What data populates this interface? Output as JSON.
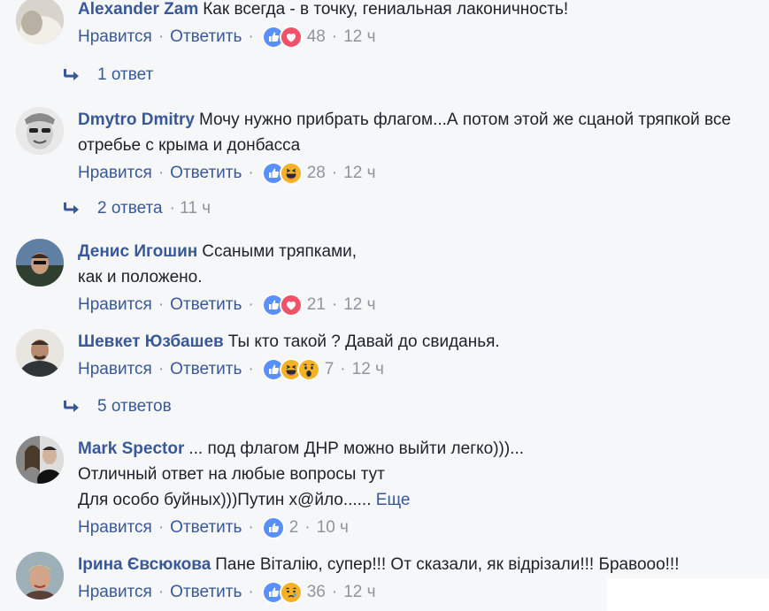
{
  "colors": {
    "link": "#385898",
    "meta": "#90949c",
    "like": "#5890ff",
    "love": "#f25268",
    "haha": "#f7b125"
  },
  "labels": {
    "like": "Нравится",
    "reply": "Ответить",
    "dot": "·",
    "more": "Еще"
  },
  "comments": [
    {
      "author": "Alexander Zam",
      "text": "Как всегда - в точку, гениальная лаконичность!",
      "reactions": [
        "like-reaction-icon",
        "love-reaction-icon"
      ],
      "count": "48",
      "time": "12 ч"
    },
    {
      "author": "Dmytro Dmitry",
      "text": "Мочу нужно прибрать флагом...А потом этой же сцаной тряпкой все отребье с крыма и донбасса",
      "reactions": [
        "like-reaction-icon",
        "haha-reaction-icon"
      ],
      "count": "28",
      "time": "12 ч"
    },
    {
      "author": "Денис Игошин",
      "text": "Ссаными тряпками,",
      "text2": "как и положено.",
      "reactions": [
        "like-reaction-icon",
        "love-reaction-icon"
      ],
      "count": "21",
      "time": "12 ч"
    },
    {
      "author": "Шевкет Юзбашев",
      "text": "Ты кто такой ? Давай до свиданья.",
      "reactions": [
        "like-reaction-icon",
        "haha-reaction-icon",
        "wow-reaction-icon"
      ],
      "count": "7",
      "time": "12 ч"
    },
    {
      "author": "Mark Spector",
      "text": "... под флагом ДНР можно выйти легко)))...",
      "text2": "Отличный ответ на любые вопросы тут",
      "text3": "Для особо буйных)))Путин х@йло......",
      "reactions": [
        "like-reaction-icon"
      ],
      "count": "2",
      "time": "10 ч"
    },
    {
      "author": "Ірина Євсюкова",
      "text": "Пане Віталію, супер!!! От сказали, як відрізали!!! Бравооо!!!",
      "reactions": [
        "like-reaction-icon",
        "sad-reaction-icon"
      ],
      "count": "36",
      "time": "12 ч"
    }
  ],
  "reply_links": [
    {
      "label": "1 ответ",
      "time": ""
    },
    {
      "label": "2 ответа",
      "time": "· 11 ч"
    },
    {
      "label": "5 ответов",
      "time": ""
    }
  ]
}
